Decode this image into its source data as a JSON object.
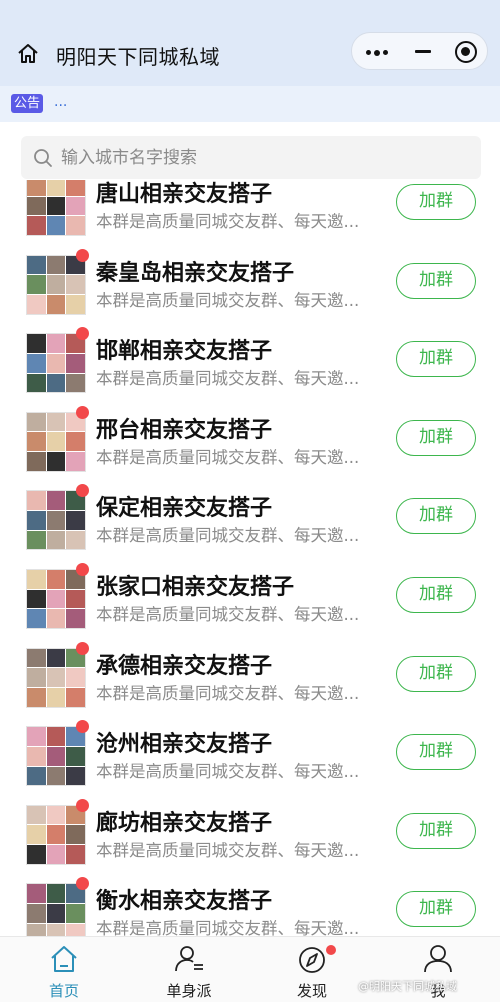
{
  "header": {
    "title": "明阳天下同城私域"
  },
  "notice": {
    "badge": "公告",
    "text": "..."
  },
  "search": {
    "placeholder": "输入城市名字搜索"
  },
  "groups": [
    {
      "name": "唐山相亲交友搭子",
      "desc": "本群是高质量同城交友群、每天邀...",
      "button": "加群",
      "has_dot": false
    },
    {
      "name": "秦皇岛相亲交友搭子",
      "desc": "本群是高质量同城交友群、每天邀...",
      "button": "加群",
      "has_dot": true
    },
    {
      "name": "邯郸相亲交友搭子",
      "desc": "本群是高质量同城交友群、每天邀...",
      "button": "加群",
      "has_dot": true
    },
    {
      "name": "邢台相亲交友搭子",
      "desc": "本群是高质量同城交友群、每天邀...",
      "button": "加群",
      "has_dot": true
    },
    {
      "name": "保定相亲交友搭子",
      "desc": "本群是高质量同城交友群、每天邀...",
      "button": "加群",
      "has_dot": true
    },
    {
      "name": "张家口相亲交友搭子",
      "desc": "本群是高质量同城交友群、每天邀...",
      "button": "加群",
      "has_dot": true
    },
    {
      "name": "承德相亲交友搭子",
      "desc": "本群是高质量同城交友群、每天邀...",
      "button": "加群",
      "has_dot": true
    },
    {
      "name": "沧州相亲交友搭子",
      "desc": "本群是高质量同城交友群、每天邀...",
      "button": "加群",
      "has_dot": true
    },
    {
      "name": "廊坊相亲交友搭子",
      "desc": "本群是高质量同城交友群、每天邀...",
      "button": "加群",
      "has_dot": true
    },
    {
      "name": "衡水相亲交友搭子",
      "desc": "本群是高质量同城交友群、每天邀...",
      "button": "加群",
      "has_dot": true
    }
  ],
  "tabbar": {
    "tabs": [
      {
        "label": "首页",
        "icon": "home-icon",
        "active": true
      },
      {
        "label": "单身派",
        "icon": "person-list-icon",
        "active": false
      },
      {
        "label": "发现",
        "icon": "compass-icon",
        "active": false,
        "has_dot": true
      },
      {
        "label": "我",
        "icon": "person-icon",
        "active": false
      }
    ]
  },
  "watermark": "@明阳天下同城私域",
  "colors": {
    "accent_green": "#3db64d",
    "active_tab": "#2b8fb8",
    "dot_red": "#f2484a",
    "header_bg": "#dfe9f8"
  }
}
